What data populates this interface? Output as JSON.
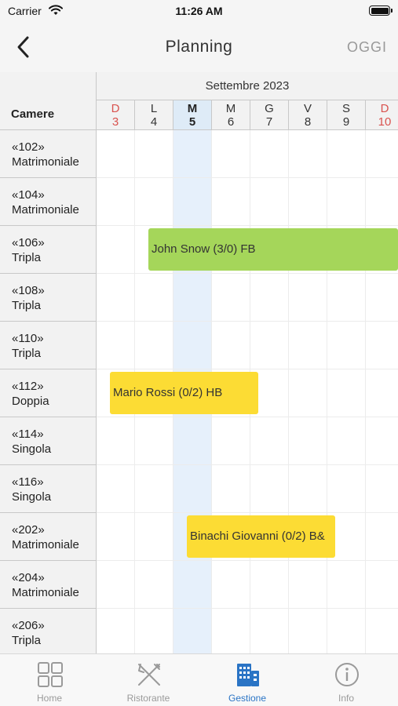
{
  "status_bar": {
    "carrier": "Carrier",
    "time": "11:26 AM"
  },
  "nav": {
    "title": "Planning",
    "today_button": "OGGI"
  },
  "planning": {
    "rooms_header": "Camere",
    "month": "Settembre 2023",
    "days": [
      {
        "letter": "D",
        "number": "3",
        "weekend": true,
        "today": false
      },
      {
        "letter": "L",
        "number": "4",
        "weekend": false,
        "today": false
      },
      {
        "letter": "M",
        "number": "5",
        "weekend": false,
        "today": true
      },
      {
        "letter": "M",
        "number": "6",
        "weekend": false,
        "today": false
      },
      {
        "letter": "G",
        "number": "7",
        "weekend": false,
        "today": false
      },
      {
        "letter": "V",
        "number": "8",
        "weekend": false,
        "today": false
      },
      {
        "letter": "S",
        "number": "9",
        "weekend": false,
        "today": false
      },
      {
        "letter": "D",
        "number": "10",
        "weekend": true,
        "today": false
      }
    ],
    "rooms": [
      {
        "number": "«102»",
        "type": "Matrimoniale"
      },
      {
        "number": "«104»",
        "type": "Matrimoniale"
      },
      {
        "number": "«106»",
        "type": "Tripla"
      },
      {
        "number": "«108»",
        "type": "Tripla"
      },
      {
        "number": "«110»",
        "type": "Tripla"
      },
      {
        "number": "«112»",
        "type": "Doppia"
      },
      {
        "number": "«114»",
        "type": "Singola"
      },
      {
        "number": "«116»",
        "type": "Singola"
      },
      {
        "number": "«202»",
        "type": "Matrimoniale"
      },
      {
        "number": "«204»",
        "type": "Matrimoniale"
      },
      {
        "number": "«206»",
        "type": "Tripla"
      }
    ],
    "bookings": [
      {
        "label": "John Snow (3/0) FB",
        "room_index": 2,
        "start_day": 1.35,
        "nights": 6.65,
        "color": "#a5d65a"
      },
      {
        "label": "Mario Rossi (0/2) HB",
        "room_index": 5,
        "start_day": 0.35,
        "nights": 3.85,
        "color": "#fcdc34"
      },
      {
        "label": "Binachi Giovanni (0/2) B&",
        "room_index": 8,
        "start_day": 2.35,
        "nights": 3.85,
        "color": "#fcdc34"
      }
    ]
  },
  "tabs": [
    {
      "label": "Home",
      "icon": "home-grid-icon",
      "active": false
    },
    {
      "label": "Ristorante",
      "icon": "fork-knife-icon",
      "active": false
    },
    {
      "label": "Gestione",
      "icon": "building-icon",
      "active": true
    },
    {
      "label": "Info",
      "icon": "info-icon",
      "active": false
    }
  ],
  "colors": {
    "accent": "#2a74c5",
    "weekend": "#d9534f",
    "today_column": "#e6f0fb"
  }
}
